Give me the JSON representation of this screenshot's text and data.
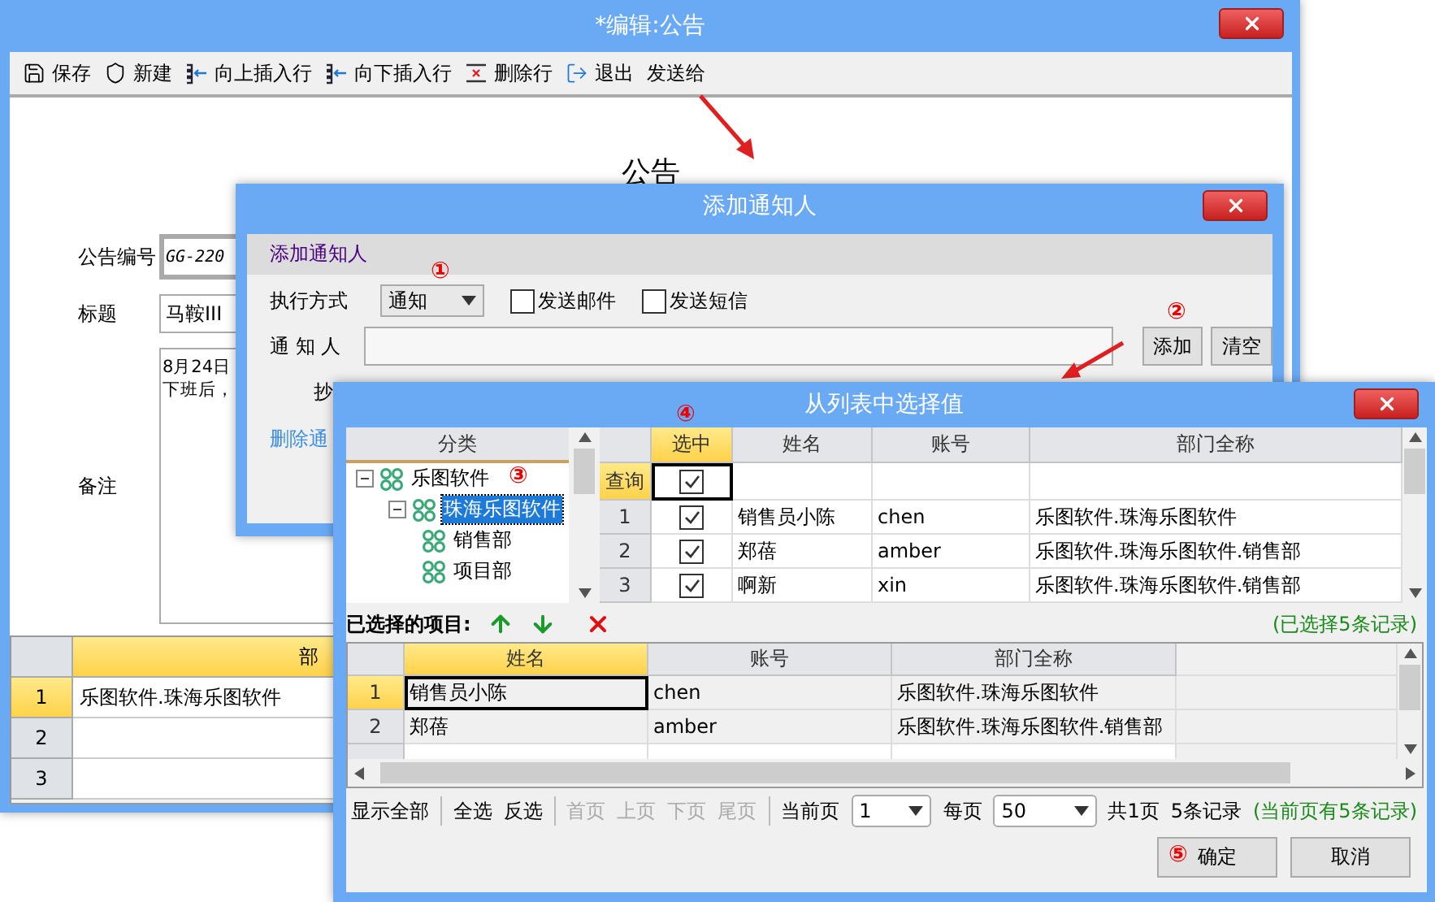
{
  "editor": {
    "title": "*编辑:公告",
    "toolbar": [
      {
        "label": "保存"
      },
      {
        "label": "新建"
      },
      {
        "label": "向上插入行"
      },
      {
        "label": "向下插入行"
      },
      {
        "label": "删除行"
      },
      {
        "label": "退出"
      },
      {
        "label": "发送给"
      }
    ],
    "heading": "公告",
    "fields": [
      {
        "kind": "code",
        "label": "公告编号",
        "value": "GG-220"
      },
      {
        "kind": "text",
        "label": "标题",
        "value": "马鞍III"
      },
      {
        "kind": "memo",
        "label": "备注",
        "lines": [
          "8月24日",
          "下班后，"
        ]
      }
    ],
    "grid": {
      "columns": [
        "部"
      ],
      "rows": [
        {
          "index": "1",
          "selected": true,
          "cells": [
            "乐图软件.珠海乐图软件"
          ]
        },
        {
          "index": "2",
          "selected": false
        },
        {
          "index": "3",
          "selected": false
        }
      ]
    }
  },
  "notify_dialog": {
    "title": "添加通知人",
    "section_title": "添加通知人",
    "mode": {
      "label": "执行方式",
      "value": "通知",
      "marker": "①"
    },
    "checkboxes": [
      {
        "label": "发送邮件",
        "checked": false
      },
      {
        "label": "发送短信",
        "checked": false
      }
    ],
    "recipients": {
      "label": "通 知 人",
      "buttons": [
        {
          "label": "添加",
          "marker": "②"
        },
        {
          "label": "清空"
        }
      ]
    },
    "cc_label": "抄",
    "link": "删除通"
  },
  "picker_dialog": {
    "title": "从列表中选择值",
    "tree": {
      "header": "分类",
      "nodes": [
        {
          "label": "乐图软件",
          "selected": false,
          "expanded": true,
          "marker": "③",
          "children": [
            {
              "label": "珠海乐图软件",
              "selected": true,
              "expanded": true,
              "children": [
                {
                  "label": "销售部",
                  "selected": false
                },
                {
                  "label": "项目部",
                  "selected": false
                }
              ]
            }
          ]
        }
      ]
    },
    "grid": {
      "columns": [
        {
          "label": "选中",
          "selected": true,
          "marker": "④"
        },
        {
          "label": "姓名",
          "selected": false
        },
        {
          "label": "账号",
          "selected": false
        },
        {
          "label": "部门全称",
          "selected": false
        }
      ],
      "filter": {
        "label": "查询",
        "checked": true
      },
      "rows": [
        {
          "index": "1",
          "checked": true,
          "name": "销售员小陈",
          "account": "chen",
          "dept": "乐图软件.珠海乐图软件"
        },
        {
          "index": "2",
          "checked": true,
          "name": "郑蓓",
          "account": "amber",
          "dept": "乐图软件.珠海乐图软件.销售部"
        },
        {
          "index": "3",
          "checked": true,
          "name": "啊新",
          "account": "xin",
          "dept": "乐图软件.珠海乐图软件.销售部"
        }
      ]
    },
    "selected_title": "已选择的项目:",
    "selected_count": "(已选择5条记录)",
    "selected_grid": {
      "columns": [
        {
          "label": "姓名",
          "selected": true
        },
        {
          "label": "账号",
          "selected": false
        },
        {
          "label": "部门全称",
          "selected": false
        }
      ],
      "rows": [
        {
          "index": "1",
          "selected": true,
          "name": "销售员小陈",
          "account": "chen",
          "dept": "乐图软件.珠海乐图软件"
        },
        {
          "index": "2",
          "selected": false,
          "name": "郑蓓",
          "account": "amber",
          "dept": "乐图软件.珠海乐图软件.销售部"
        }
      ]
    },
    "pager": [
      {
        "kind": "link",
        "label": "显示全部",
        "disabled": false
      },
      {
        "kind": "sep"
      },
      {
        "kind": "link",
        "label": "全选",
        "disabled": false
      },
      {
        "kind": "link",
        "label": "反选",
        "disabled": false
      },
      {
        "kind": "sep"
      },
      {
        "kind": "link",
        "label": "首页",
        "disabled": true
      },
      {
        "kind": "link",
        "label": "上页",
        "disabled": true
      },
      {
        "kind": "link",
        "label": "下页",
        "disabled": true
      },
      {
        "kind": "link",
        "label": "尾页",
        "disabled": true
      },
      {
        "kind": "sep"
      },
      {
        "kind": "text",
        "label": "当前页"
      },
      {
        "kind": "select",
        "label": "1"
      },
      {
        "kind": "text",
        "label": "每页"
      },
      {
        "kind": "select",
        "label": "50"
      },
      {
        "kind": "text",
        "label": "共1页"
      },
      {
        "kind": "text",
        "label": "5条记录"
      }
    ],
    "page_count": "(当前页有5条记录)",
    "buttons": [
      {
        "label": "确定",
        "marker": "⑤"
      },
      {
        "label": "取消"
      }
    ]
  }
}
